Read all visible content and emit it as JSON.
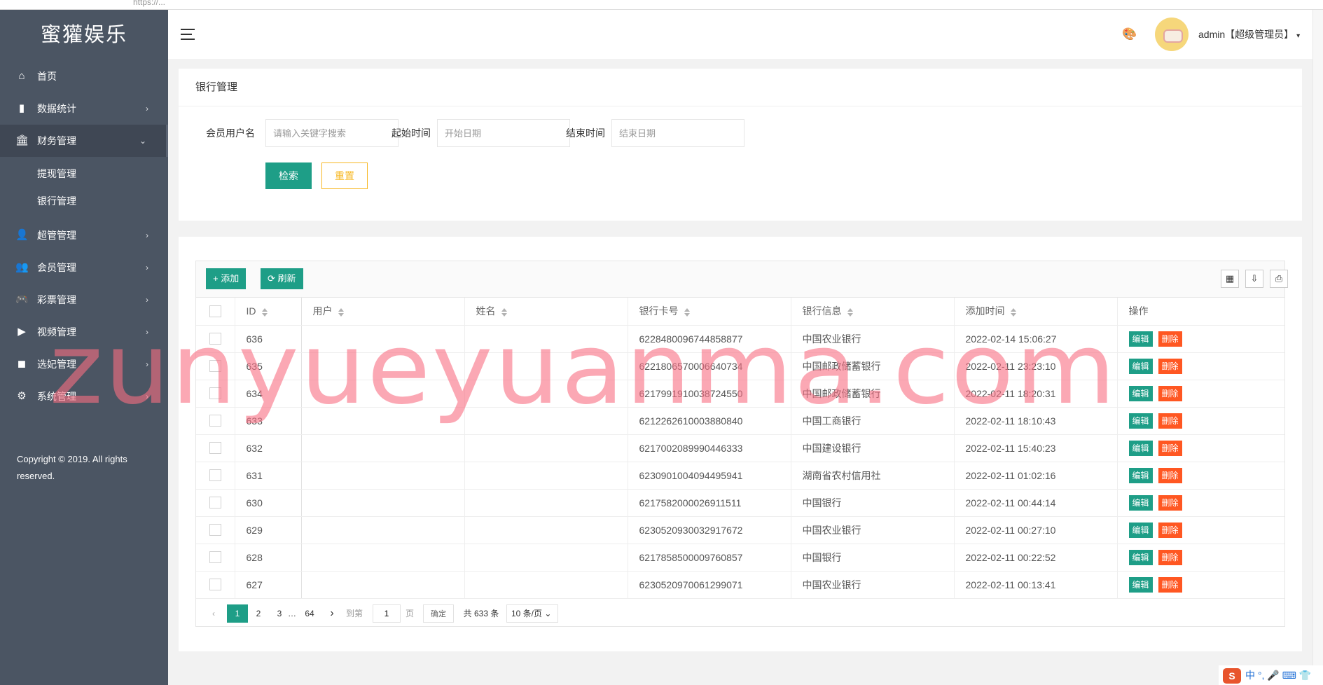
{
  "browser": {
    "url": "https://..."
  },
  "sidebar": {
    "logo": "蜜獾娱乐",
    "items": [
      {
        "label": "首页",
        "icon": "home-icon",
        "glyph": "⌂",
        "arrow": ""
      },
      {
        "label": "数据统计",
        "icon": "bar-chart-icon",
        "glyph": "▮",
        "arrow": "›"
      },
      {
        "label": "财务管理",
        "icon": "bank-icon",
        "glyph": "🏛",
        "arrow": "⌄"
      },
      {
        "label": "超管管理",
        "icon": "user-icon",
        "glyph": "👤",
        "arrow": "›"
      },
      {
        "label": "会员管理",
        "icon": "users-icon",
        "glyph": "👥",
        "arrow": "›"
      },
      {
        "label": "彩票管理",
        "icon": "gamepad-icon",
        "glyph": "🎮",
        "arrow": "›"
      },
      {
        "label": "视频管理",
        "icon": "video-icon",
        "glyph": "▶",
        "arrow": "›"
      },
      {
        "label": "选妃管理",
        "icon": "camera-icon",
        "glyph": "◼",
        "arrow": "›"
      },
      {
        "label": "系统管理",
        "icon": "gear-icon",
        "glyph": "⚙",
        "arrow": "›"
      }
    ],
    "sub_items": [
      "提现管理",
      "银行管理"
    ],
    "copyright": "Copyright © 2019. All rights reserved."
  },
  "header": {
    "user": "admin【超级管理员】",
    "caret": "▾",
    "palette_glyph": "🎨"
  },
  "search": {
    "title": "银行管理",
    "fields": [
      {
        "label": "会员用户名",
        "placeholder": "请输入关键字搜索"
      },
      {
        "label": "起始时间",
        "placeholder": "开始日期"
      },
      {
        "label": "结束时间",
        "placeholder": "结束日期"
      }
    ],
    "search_button": "检索",
    "reset_button": "重置"
  },
  "toolbar": {
    "add_label": "+ 添加",
    "refresh_label": "⟳ 刷新",
    "tool_icons": [
      "▦",
      "⇩",
      "⎙"
    ]
  },
  "table": {
    "columns": [
      "ID",
      "用户",
      "姓名",
      "银行卡号",
      "银行信息",
      "添加时间",
      "操作"
    ],
    "edit_label": "编辑",
    "delete_label": "删除",
    "rows": [
      {
        "id": "636",
        "user": "",
        "name": "",
        "card": "6228480096744858877",
        "bank": "中国农业银行",
        "time": "2022-02-14 15:06:27"
      },
      {
        "id": "635",
        "user": "",
        "name": "",
        "card": "6221806570006640734",
        "bank": "中国邮政储蓄银行",
        "time": "2022-02-11 23:23:10"
      },
      {
        "id": "634",
        "user": "",
        "name": "",
        "card": "6217991910038724550",
        "bank": "中国邮政储蓄银行",
        "time": "2022-02-11 18:20:31"
      },
      {
        "id": "633",
        "user": "",
        "name": "",
        "card": "6212262610003880840",
        "bank": "中国工商银行",
        "time": "2022-02-11 18:10:43"
      },
      {
        "id": "632",
        "user": "",
        "name": "",
        "card": "6217002089990446333",
        "bank": "中国建设银行",
        "time": "2022-02-11 15:40:23"
      },
      {
        "id": "631",
        "user": "",
        "name": "",
        "card": "6230901004094495941",
        "bank": "湖南省农村信用社",
        "time": "2022-02-11 01:02:16"
      },
      {
        "id": "630",
        "user": "",
        "name": "",
        "card": "6217582000026911511",
        "bank": "中国银行",
        "time": "2022-02-11 00:44:14"
      },
      {
        "id": "629",
        "user": "",
        "name": "",
        "card": "6230520930032917672",
        "bank": "中国农业银行",
        "time": "2022-02-11 00:27:10"
      },
      {
        "id": "628",
        "user": "",
        "name": "",
        "card": "6217858500009760857",
        "bank": "中国银行",
        "time": "2022-02-11 00:22:52"
      },
      {
        "id": "627",
        "user": "",
        "name": "",
        "card": "6230520970061299071",
        "bank": "中国农业银行",
        "time": "2022-02-11 00:13:41"
      }
    ]
  },
  "pagination": {
    "prev": "‹",
    "next": "›",
    "pages": [
      "1",
      "2",
      "3"
    ],
    "ellipsis": "…",
    "last": "64",
    "goto_label": "到第",
    "goto_value": "1",
    "page_unit": "页",
    "confirm": "确定",
    "total": "共 633 条",
    "page_size": "10 条/页"
  },
  "watermark": "zunyueyuanma.com",
  "ime": {
    "logo": "S",
    "text": "中 °, 🎤 ⌨ 👕"
  },
  "colors": {
    "primary": "#1e9e87",
    "danger": "#ff5722",
    "warning": "#f7b824",
    "sidebar": "#4b5563"
  }
}
